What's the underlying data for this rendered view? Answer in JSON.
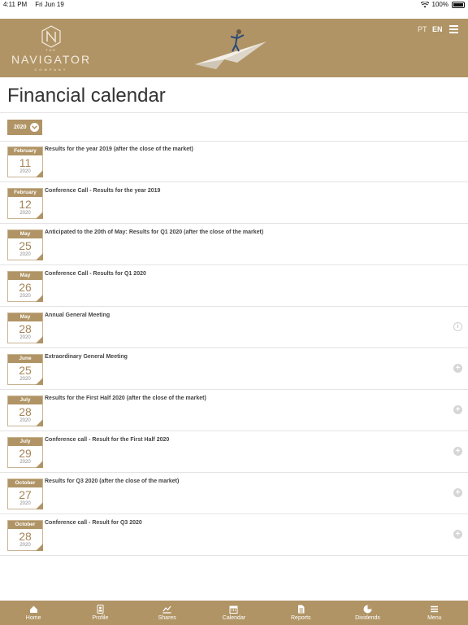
{
  "status": {
    "time": "4:11 PM",
    "date": "Fri Jun 19",
    "battery": "100%"
  },
  "header": {
    "logo_the": "THE",
    "logo_word": "NAVIGATOR",
    "logo_sub": "COMPANY",
    "lang_pt": "PT",
    "lang_en": "EN"
  },
  "page_title": "Financial calendar",
  "year_filter": {
    "value": "2020"
  },
  "events": [
    {
      "month": "February",
      "day": "11",
      "year": "2020",
      "title": "Results for the year 2019 (after the close of the market)",
      "action": ""
    },
    {
      "month": "February",
      "day": "12",
      "year": "2020",
      "title": "Conference Call - Results for the year 2019",
      "action": ""
    },
    {
      "month": "May",
      "day": "25",
      "year": "2020",
      "title": "Anticipated to the 20th of May: Results for Q1 2020 (after the close of the market)",
      "action": ""
    },
    {
      "month": "May",
      "day": "26",
      "year": "2020",
      "title": "Conference Call - Results for Q1 2020",
      "action": ""
    },
    {
      "month": "May",
      "day": "28",
      "year": "2020",
      "title": "Annual General Meeting",
      "action": "info"
    },
    {
      "month": "June",
      "day": "25",
      "year": "2020",
      "title": "Extraordinary General Meeting",
      "action": "plus"
    },
    {
      "month": "July",
      "day": "28",
      "year": "2020",
      "title": "Results for the First Half 2020 (after the close of the market)",
      "action": "plus"
    },
    {
      "month": "July",
      "day": "29",
      "year": "2020",
      "title": "Conference call - Result for the First Half 2020",
      "action": "plus"
    },
    {
      "month": "October",
      "day": "27",
      "year": "2020",
      "title": "Results for Q3 2020 (after the close of the market)",
      "action": "plus"
    },
    {
      "month": "October",
      "day": "28",
      "year": "2020",
      "title": "Conference call - Result for Q3 2020",
      "action": "plus"
    }
  ],
  "tabs": [
    {
      "label": "Home",
      "icon": "home-icon"
    },
    {
      "label": "Profile",
      "icon": "profile-icon"
    },
    {
      "label": "Shares",
      "icon": "chart-icon"
    },
    {
      "label": "Calendar",
      "icon": "calendar-icon"
    },
    {
      "label": "Reports",
      "icon": "document-icon"
    },
    {
      "label": "Dividends",
      "icon": "pie-icon"
    },
    {
      "label": "Menu",
      "icon": "menu-icon"
    }
  ],
  "colors": {
    "brand": "#b09465",
    "accent_text": "#a48658"
  }
}
